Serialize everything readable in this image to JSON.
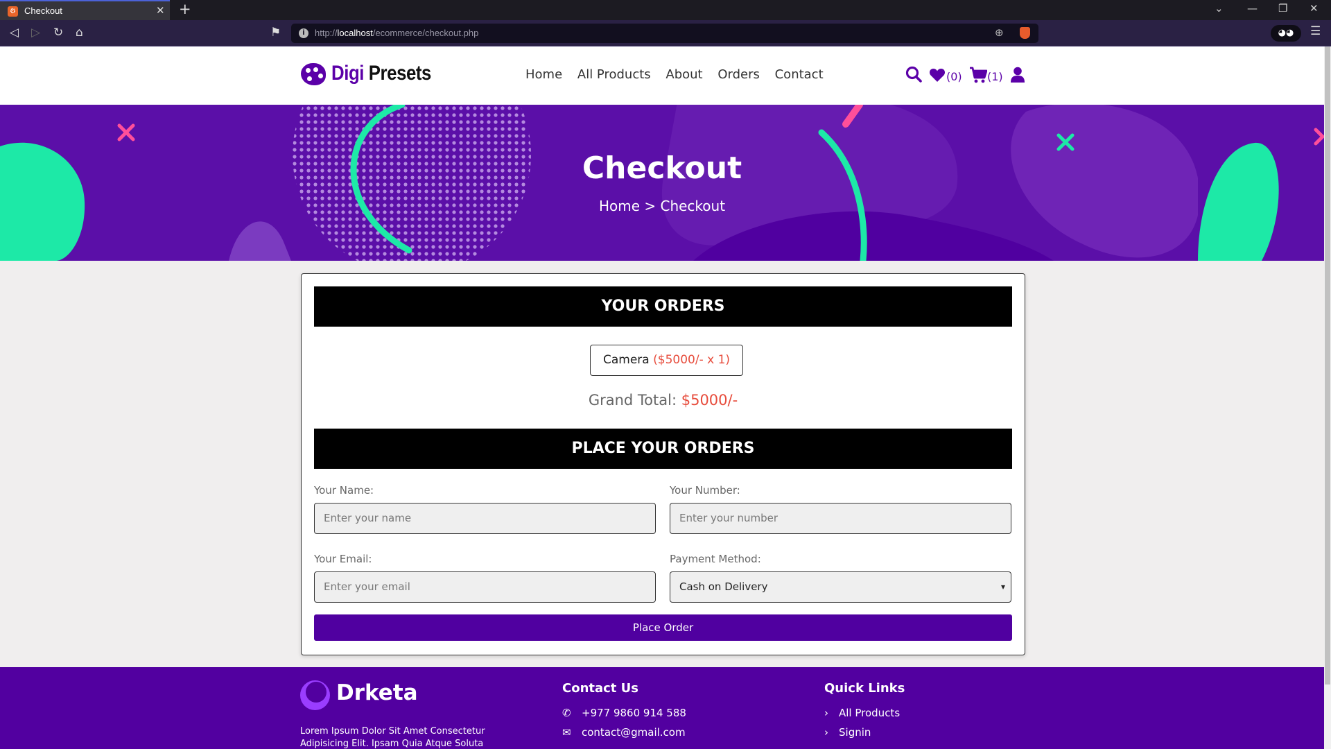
{
  "browser": {
    "tab_title": "Checkout",
    "tab_close": "✕",
    "new_tab": "+",
    "url_host": "localhost",
    "url_prefix": "http://",
    "url_path": "/ecommerce/checkout.php"
  },
  "header": {
    "logo_first": "Digi",
    "logo_second": " Presets",
    "nav": [
      "Home",
      "All Products",
      "About",
      "Orders",
      "Contact"
    ],
    "wishlist_count": "(0)",
    "cart_count": "(1)"
  },
  "hero": {
    "title": "Checkout",
    "breadcrumb": "Home > Checkout"
  },
  "orders": {
    "heading": "YOUR ORDERS",
    "item_name": "Camera",
    "item_price": "($5000/- x 1)",
    "grand_label": "Grand Total:",
    "grand_value": "$5000/-"
  },
  "form": {
    "heading": "PLACE YOUR ORDERS",
    "name_label": "Your Name:",
    "name_placeholder": "Enter your name",
    "number_label": "Your Number:",
    "number_placeholder": "Enter your number",
    "email_label": "Your Email:",
    "email_placeholder": "Enter your email",
    "payment_label": "Payment Method:",
    "payment_value": "Cash on Delivery",
    "submit": "Place Order"
  },
  "footer": {
    "brand": "Drketa",
    "desc": "Lorem Ipsum Dolor Sit Amet Consectetur Adipisicing Elit. Ipsam Quia Atque Soluta",
    "contact_heading": "Contact Us",
    "phone": "+977 9860 914 588",
    "email": "contact@gmail.com",
    "links_heading": "Quick Links",
    "link_1": "All Products",
    "link_2": "Signin"
  },
  "colors": {
    "brand_purple": "#5b00a8",
    "price_red": "#e74c3c",
    "hero_green": "#1de9a7",
    "hero_pink": "#ff4f9a"
  }
}
